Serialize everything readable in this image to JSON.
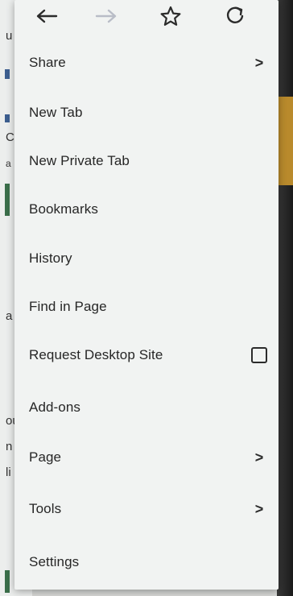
{
  "toolbar": {
    "back_icon": "arrow-left",
    "forward_icon": "arrow-right",
    "bookmark_icon": "star-outline",
    "reload_icon": "reload"
  },
  "menu": {
    "items": [
      {
        "label": "Share",
        "trailing": "chevron"
      },
      {
        "label": "New Tab",
        "trailing": ""
      },
      {
        "label": "New Private Tab",
        "trailing": ""
      },
      {
        "label": "Bookmarks",
        "trailing": ""
      },
      {
        "label": "History",
        "trailing": ""
      },
      {
        "label": "Find in Page",
        "trailing": ""
      },
      {
        "label": "Request Desktop Site",
        "trailing": "checkbox",
        "checked": false
      },
      {
        "label": "Add-ons",
        "trailing": ""
      },
      {
        "label": "Page",
        "trailing": "chevron"
      },
      {
        "label": "Tools",
        "trailing": "chevron"
      },
      {
        "label": "Settings",
        "trailing": ""
      }
    ],
    "chevron_glyph": ">"
  },
  "background": {
    "fragments": [
      "u",
      "C",
      "a",
      "a",
      "ou",
      "n",
      "li"
    ]
  },
  "colors": {
    "menu_bg": "#f1f3f2",
    "text": "#262626",
    "forward_disabled": "#b9bdc7"
  }
}
